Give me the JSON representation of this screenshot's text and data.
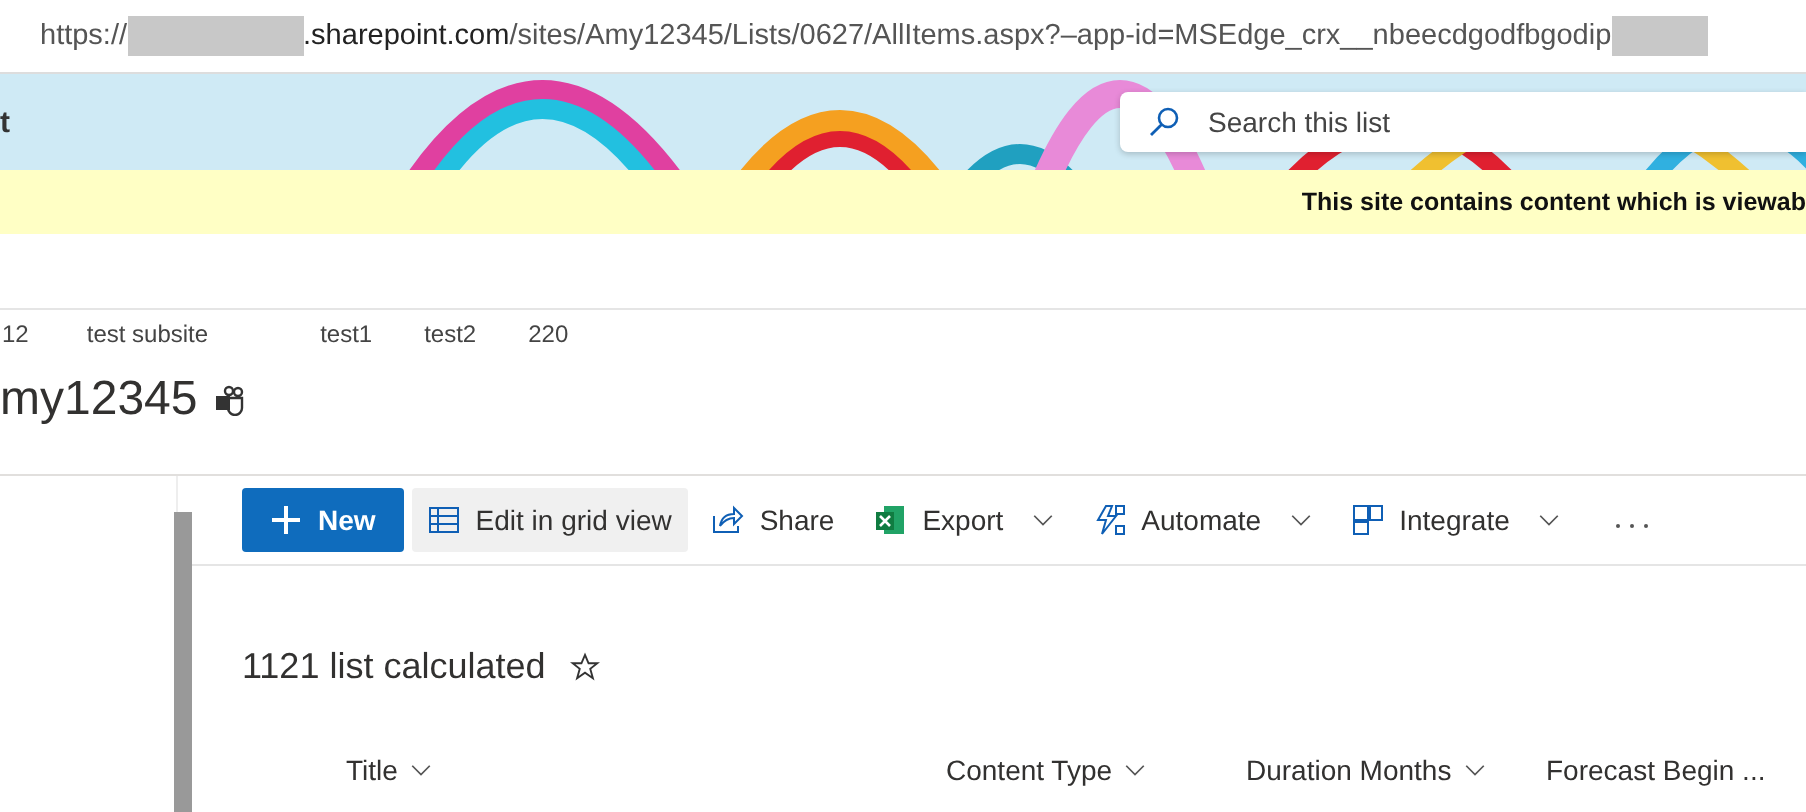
{
  "address_bar": {
    "scheme": "https://",
    "host": ".sharepoint.com",
    "path": "/sites/Amy12345/Lists/0627/AllItems.aspx?–app-id=MSEdge_crx__nbeecdgodfbgodip"
  },
  "header": {
    "site_title": "t",
    "search": {
      "placeholder": "Search this list"
    }
  },
  "notice": {
    "lines": [
      "This site contains content which is viewab"
    ]
  },
  "site_nav": {
    "items": [
      "12",
      "test subsite",
      "test1",
      "test2",
      "220"
    ]
  },
  "site": {
    "title": "my12345"
  },
  "command_bar": {
    "buttons": [
      {
        "label": "New",
        "kind": "primary",
        "selected": false,
        "dropdown": false
      },
      {
        "label": "Edit in grid view",
        "kind": "grid",
        "selected": true,
        "dropdown": false
      },
      {
        "label": "Share",
        "kind": "share",
        "selected": false,
        "dropdown": false
      },
      {
        "label": "Export",
        "kind": "excel",
        "selected": false,
        "dropdown": true
      },
      {
        "label": "Automate",
        "kind": "automate",
        "selected": false,
        "dropdown": true
      },
      {
        "label": "Integrate",
        "kind": "integrate",
        "selected": false,
        "dropdown": true
      }
    ]
  },
  "list": {
    "title": "1121 list calculated",
    "favorite": false,
    "columns": [
      "Title",
      "Content Type",
      "Duration Months",
      "Forecast Begin ..."
    ]
  }
}
